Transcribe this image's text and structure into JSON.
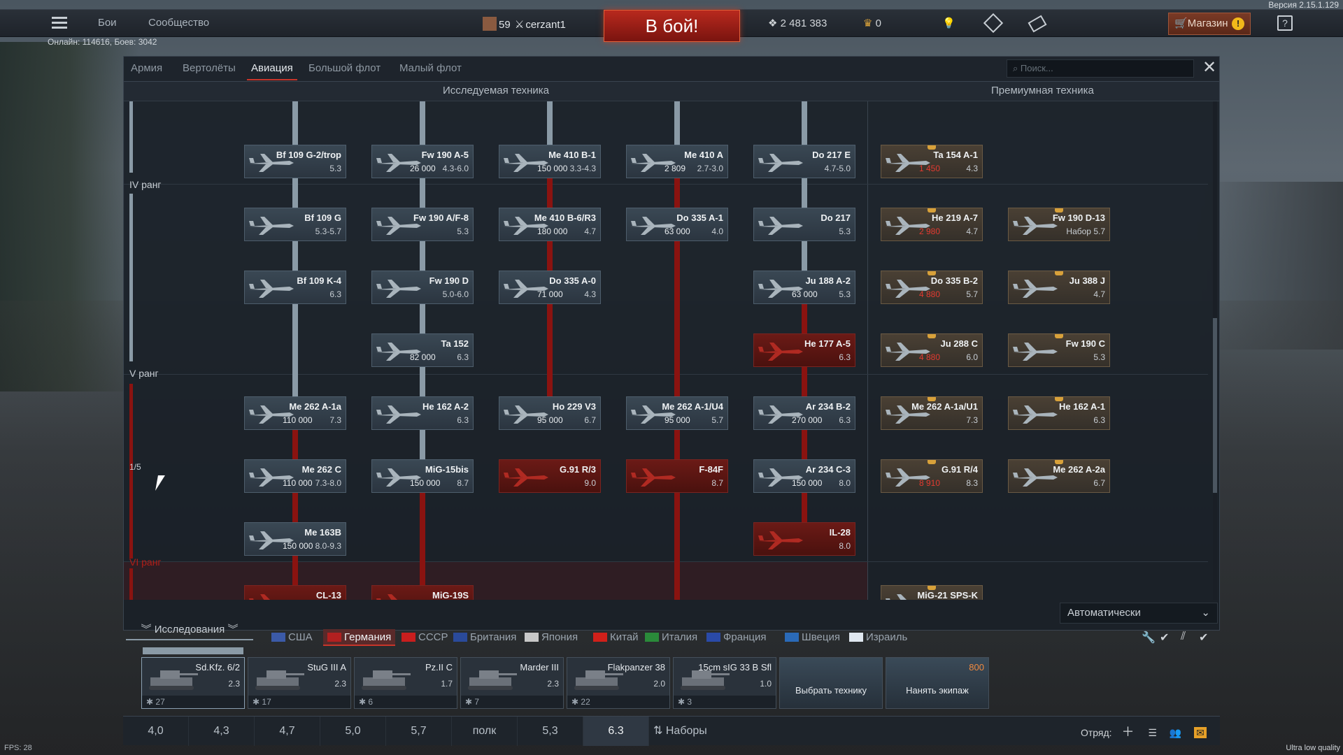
{
  "version": "Версия 2.15.1.129",
  "topbar": {
    "battles": "Бои",
    "community": "Сообщество",
    "rank": "59",
    "player": "cerzant1",
    "battle_button": "В бой!",
    "silver": "2 481 383",
    "gold": "0",
    "shop": "Магазин",
    "help": "?"
  },
  "online": "Онлайн: 114616, Боев: 3042",
  "tabs": [
    "Армия",
    "Вертолёты",
    "Авиация",
    "Большой флот",
    "Малый флот"
  ],
  "active_tab": "Авиация",
  "search_placeholder": "Поиск...",
  "section_researched": "Исследуемая техника",
  "section_premium": "Премиумная техника",
  "ranks": {
    "iv": "IV ранг",
    "v": "V ранг",
    "vi": "VI ранг",
    "progress": "1/5"
  },
  "cards": [
    {
      "id": "bf109g2",
      "name": "Bf 109 G-2/trop",
      "br": "5.3",
      "cost": "",
      "kind": "normal"
    },
    {
      "id": "fw190a5",
      "name": "Fw 190 A-5",
      "br": "4.3-6.0",
      "cost": "26 000",
      "kind": "normal"
    },
    {
      "id": "me410b1",
      "name": "Me 410 B-1",
      "br": "3.3-4.3",
      "cost": "150 000",
      "kind": "normal"
    },
    {
      "id": "me410a",
      "name": "Me 410 A",
      "br": "2.7-3.0",
      "cost": "2 809",
      "kind": "normal"
    },
    {
      "id": "do217e",
      "name": "Do 217 E",
      "br": "4.7-5.0",
      "cost": "",
      "kind": "normal"
    },
    {
      "id": "ta154",
      "name": "Ta 154 A-1",
      "br": "4.3",
      "cost": "1 450",
      "kind": "prem"
    },
    {
      "id": "bf109g",
      "name": "Bf 109 G",
      "br": "5.3-5.7",
      "cost": "",
      "kind": "normal"
    },
    {
      "id": "fw190af8",
      "name": "Fw 190 A/F-8",
      "br": "5.3",
      "cost": "",
      "kind": "normal"
    },
    {
      "id": "me410b6",
      "name": "Me 410 B-6/R3",
      "br": "4.7",
      "cost": "180 000",
      "kind": "normal"
    },
    {
      "id": "do335a1",
      "name": "Do 335 A-1",
      "br": "4.0",
      "cost": "63 000",
      "kind": "normal"
    },
    {
      "id": "do217",
      "name": "Do 217",
      "br": "5.3",
      "cost": "",
      "kind": "normal"
    },
    {
      "id": "he219",
      "name": "He 219 A-7",
      "br": "4.7",
      "cost": "2 980",
      "kind": "prem"
    },
    {
      "id": "fw190d13",
      "name": "Fw 190 D-13",
      "br": "Набор 5.7",
      "cost": "",
      "kind": "prem"
    },
    {
      "id": "bf109k4",
      "name": "Bf 109 K-4",
      "br": "6.3",
      "cost": "",
      "kind": "normal"
    },
    {
      "id": "fw190d",
      "name": "Fw 190 D",
      "br": "5.0-6.0",
      "cost": "",
      "kind": "normal"
    },
    {
      "id": "do335a0",
      "name": "Do 335 A-0",
      "br": "4.3",
      "cost": "71 000",
      "kind": "normal"
    },
    {
      "id": "ju188",
      "name": "Ju 188 A-2",
      "br": "5.3",
      "cost": "63 000",
      "kind": "normal"
    },
    {
      "id": "do335b2",
      "name": "Do 335 B-2",
      "br": "5.7",
      "cost": "4 880",
      "kind": "prem"
    },
    {
      "id": "ju388",
      "name": "Ju 388 J",
      "br": "4.7",
      "cost": "",
      "kind": "prem"
    },
    {
      "id": "ta152",
      "name": "Ta 152",
      "br": "6.3",
      "cost": "82 000",
      "kind": "normal"
    },
    {
      "id": "he177",
      "name": "He 177 A-5",
      "br": "6.3",
      "cost": "",
      "kind": "locked"
    },
    {
      "id": "ju288",
      "name": "Ju 288 C",
      "br": "6.0",
      "cost": "4 880",
      "kind": "prem"
    },
    {
      "id": "fw190c",
      "name": "Fw 190 C",
      "br": "5.3",
      "cost": "",
      "kind": "prem"
    },
    {
      "id": "me262a1a",
      "name": "Me 262 A-1a",
      "br": "7.3",
      "cost": "110 000",
      "kind": "normal"
    },
    {
      "id": "he162a2",
      "name": "He 162 A-2",
      "br": "6.3",
      "cost": "",
      "kind": "normal"
    },
    {
      "id": "ho229",
      "name": "Ho 229 V3",
      "br": "6.7",
      "cost": "95 000",
      "kind": "normal"
    },
    {
      "id": "me262a1u4",
      "name": "Me 262 A-1/U4",
      "br": "5.7",
      "cost": "95 000",
      "kind": "normal"
    },
    {
      "id": "ar234b2",
      "name": "Ar 234 B-2",
      "br": "6.3",
      "cost": "270 000",
      "kind": "normal"
    },
    {
      "id": "me262a1au1",
      "name": "Me 262 A-1a/U1",
      "br": "7.3",
      "cost": "",
      "kind": "prem"
    },
    {
      "id": "he162a1",
      "name": "He 162 A-1",
      "br": "6.3",
      "cost": "",
      "kind": "prem"
    },
    {
      "id": "me262c",
      "name": "Me 262 C",
      "br": "7.3-8.0",
      "cost": "110 000",
      "kind": "normal"
    },
    {
      "id": "mig15",
      "name": "MiG-15bis",
      "br": "8.7",
      "cost": "150 000",
      "kind": "normal"
    },
    {
      "id": "g91r3",
      "name": "G.91 R/3",
      "br": "9.0",
      "cost": "",
      "kind": "locked"
    },
    {
      "id": "f84f",
      "name": "F-84F",
      "br": "8.7",
      "cost": "",
      "kind": "locked"
    },
    {
      "id": "ar234c3",
      "name": "Ar 234 C-3",
      "br": "8.0",
      "cost": "150 000",
      "kind": "normal"
    },
    {
      "id": "g91r4",
      "name": "G.91 R/4",
      "br": "8.3",
      "cost": "8 910",
      "kind": "prem"
    },
    {
      "id": "me262a2a",
      "name": "Me 262 A-2a",
      "br": "6.7",
      "cost": "",
      "kind": "prem"
    },
    {
      "id": "me163b",
      "name": "Me 163B",
      "br": "8.0-9.3",
      "cost": "150 000",
      "kind": "normal"
    },
    {
      "id": "il28",
      "name": "IL-28",
      "br": "8.0",
      "cost": "",
      "kind": "locked"
    },
    {
      "id": "cl13",
      "name": "CL-13",
      "br": "",
      "cost": "",
      "kind": "locked"
    },
    {
      "id": "mig19",
      "name": "MiG-19S",
      "br": "",
      "cost": "",
      "kind": "locked"
    },
    {
      "id": "mig21",
      "name": "MiG-21 SPS-K",
      "br": "",
      "cost": "",
      "kind": "prem"
    }
  ],
  "research_label": "Исследования",
  "auto_select": "Автоматически",
  "nations": [
    "США",
    "Германия",
    "СССР",
    "Британия",
    "Япония",
    "Китай",
    "Италия",
    "Франция",
    "Швеция",
    "Израиль"
  ],
  "active_nation": "Германия",
  "crew": [
    {
      "name": "Sd.Kfz. 6/2",
      "br": "2.3",
      "count": "27"
    },
    {
      "name": "StuG III A",
      "br": "2.3",
      "count": "17"
    },
    {
      "name": "Pz.II C",
      "br": "1.7",
      "count": "6"
    },
    {
      "name": "Marder III",
      "br": "2.3",
      "count": "7"
    },
    {
      "name": "Flakpanzer 38",
      "br": "2.0",
      "count": "22"
    },
    {
      "name": "15cm sIG 33 B Sfl",
      "br": "1.0",
      "count": "3"
    }
  ],
  "choose_vehicle": "Выбрать технику",
  "hire_crew": "Нанять экипаж",
  "hire_cost": "800",
  "br_list": [
    "4,0",
    "4,3",
    "4,7",
    "5,0",
    "5,7",
    "полк",
    "5,3",
    "6.3"
  ],
  "br_active": "6.3",
  "sets": "Наборы",
  "squad": "Отряд:",
  "fps": "FPS: 28",
  "quality": "Ultra low quality",
  "colors": {
    "accent_red": "#c8352a",
    "battle_red": "#b8291e",
    "researched_line": "#8a9aa6",
    "locked_line": "#8a1310",
    "gold": "#d8a13a"
  }
}
